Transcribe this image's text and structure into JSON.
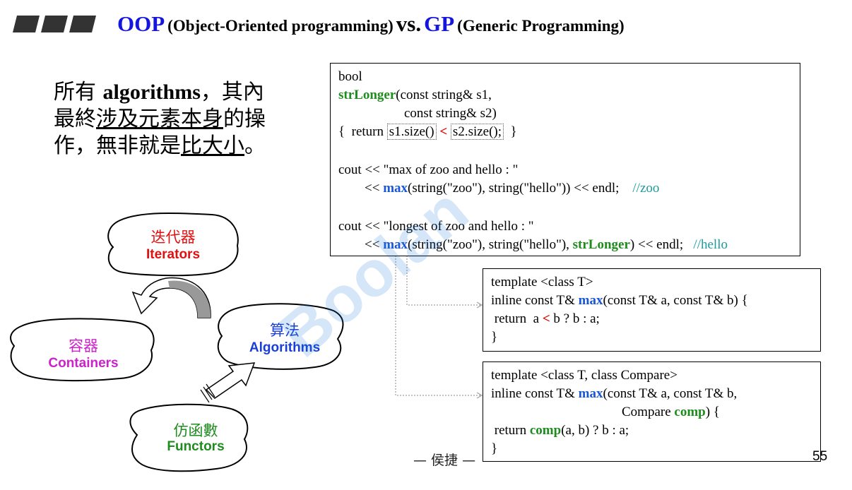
{
  "header": {
    "oop": "OOP",
    "oop_full": "(Object-Oriented programming)",
    "vs": "vs.",
    "gp": "GP",
    "gp_full": "(Generic Programming)"
  },
  "left_text": {
    "line1_a": "所有 ",
    "line1_b": "algorithms",
    "line1_c": "，其內",
    "line2_a": "最終",
    "line2_b": "涉及元素本身",
    "line2_c": "的操",
    "line3_a": "作，無非就是",
    "line3_b": "比大小",
    "line3_c": "。"
  },
  "box1": {
    "l1": "bool",
    "l2_fn": "strLonger",
    "l2_rest": "(const string& s1,",
    "l3": "const string& s2)",
    "l4_a": "{  return ",
    "l4_b": "s1.size()",
    "l4_lt": "<",
    "l4_c": "s2.size();",
    "l4_d": "}",
    "l6": "cout << \"max of zoo and hello : \"",
    "l7_a": "<< ",
    "l7_max": "max",
    "l7_b": "(string(\"zoo\"), string(\"hello\")) << endl;",
    "l7_cm": "//zoo",
    "l9": "cout << \"longest of zoo and hello : \"",
    "l10_a": "<< ",
    "l10_max": "max",
    "l10_b": "(string(\"zoo\"), string(\"hello\"), ",
    "l10_fn": "strLonger",
    "l10_c": ") << endl;",
    "l10_cm": "//hello"
  },
  "box2": {
    "l1": "template <class T>",
    "l2_a": "inline const T& ",
    "l2_max": "max",
    "l2_b": "(const T& a, const T& b) {",
    "l3_a": " return  a ",
    "l3_lt": "<",
    "l3_b": " b ? b : a;",
    "l4": "}"
  },
  "box3": {
    "l1": "template <class T, class Compare>",
    "l2_a": "inline const T& ",
    "l2_max": "max",
    "l2_b": "(const T& a, const T& b,",
    "l3_a": "Compare ",
    "l3_comp": "comp",
    "l3_b": ") {",
    "l4_a": " return ",
    "l4_comp": "comp",
    "l4_b": "(a, b) ? b : a;",
    "l5": "}"
  },
  "blobs": {
    "iterators_cn": "迭代器",
    "iterators_en": "Iterators",
    "containers_cn": "容器",
    "containers_en": "Containers",
    "algorithms_cn": "算法",
    "algorithms_en": "Algorithms",
    "functors_cn": "仿函數",
    "functors_en": "Functors"
  },
  "colors": {
    "iterators": "#e01010",
    "containers": "#cc22cc",
    "algorithms": "#1a3fd6",
    "functors": "#1e8c1e"
  },
  "footer": {
    "author": "— 侯捷 —",
    "page": "55"
  }
}
